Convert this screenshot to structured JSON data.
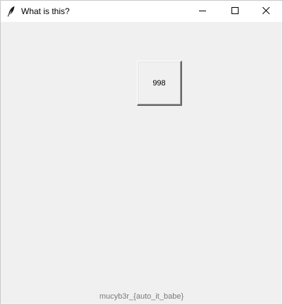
{
  "window": {
    "title": "What is this?",
    "controls": {
      "minimize_icon": "minimize-icon",
      "maximize_icon": "maximize-icon",
      "close_icon": "close-icon"
    },
    "app_icon": "feather-icon"
  },
  "main": {
    "button_label": "998",
    "footer_text": "mucyb3r_{auto_it_babe}"
  },
  "colors": {
    "window_background": "#f0f0f0",
    "titlebar_background": "#ffffff",
    "footer_text": "#7a7a7a"
  }
}
